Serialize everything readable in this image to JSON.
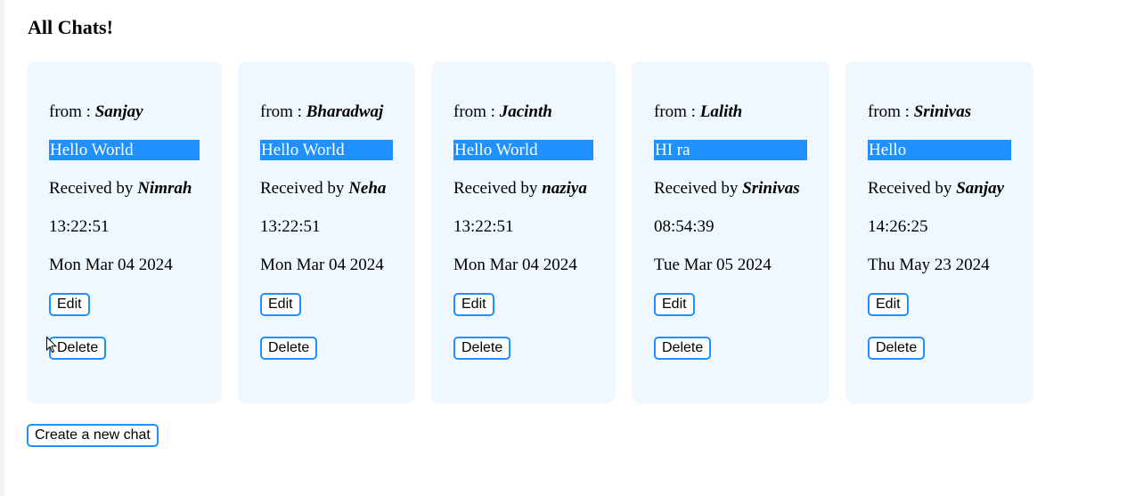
{
  "page": {
    "title": "All Chats!"
  },
  "labels": {
    "from": "from : ",
    "received_by": "Received by "
  },
  "chats": [
    {
      "from": "Sanjay",
      "message": "Hello World",
      "to": "Nimrah",
      "time": "13:22:51",
      "date": "Mon Mar 04 2024",
      "edit": "Edit",
      "delete": "Delete"
    },
    {
      "from": "Bharadwaj",
      "message": "Hello World",
      "to": "Neha",
      "time": "13:22:51",
      "date": "Mon Mar 04 2024",
      "edit": "Edit",
      "delete": "Delete"
    },
    {
      "from": "Jacinth",
      "message": "Hello World",
      "to": "naziya",
      "time": "13:22:51",
      "date": "Mon Mar 04 2024",
      "edit": "Edit",
      "delete": "Delete"
    },
    {
      "from": "Lalith",
      "message": "HI ra",
      "to": "Srinivas",
      "time": "08:54:39",
      "date": "Tue Mar 05 2024",
      "edit": "Edit",
      "delete": "Delete"
    },
    {
      "from": "Srinivas",
      "message": "Hello",
      "to": "Sanjay",
      "time": "14:26:25",
      "date": "Thu May 23 2024",
      "edit": "Edit",
      "delete": "Delete"
    }
  ],
  "actions": {
    "create_new_chat": "Create a new chat"
  },
  "colors": {
    "card_bg": "#eff7ff",
    "highlight": "#1e90ff",
    "button_border": "#1e90ff"
  },
  "icons": {
    "cursor": "mouse-pointer-icon"
  }
}
